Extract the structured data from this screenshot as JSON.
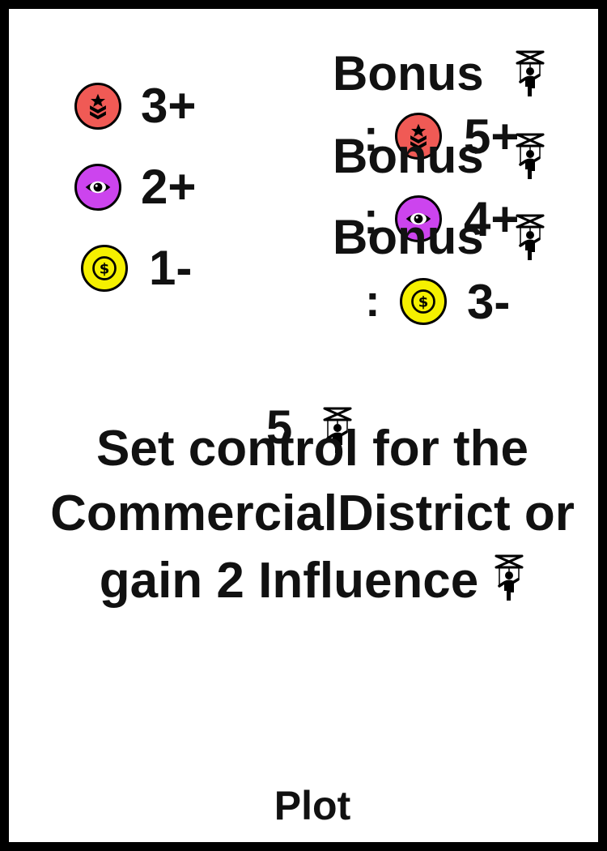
{
  "requirements": [
    {
      "icon": "military-badge-icon",
      "color": "#F05A55",
      "value": "3+"
    },
    {
      "icon": "eye-icon",
      "color": "#CC44EE",
      "value": "2+"
    },
    {
      "icon": "dollar-coin-icon",
      "color": "#F5F000",
      "value": "1-"
    }
  ],
  "bonuses": [
    {
      "label": "Bonus",
      "colon": ":",
      "icon": "military-badge-icon",
      "color": "#F05A55",
      "value": "5+",
      "reward_icon": "puppet-icon"
    },
    {
      "label": "Bonus",
      "colon": ":",
      "icon": "eye-icon",
      "color": "#CC44EE",
      "value": "4+",
      "reward_icon": "puppet-icon"
    },
    {
      "label": "Bonus",
      "colon": ":",
      "icon": "dollar-coin-icon",
      "color": "#F5F000",
      "value": "3-",
      "reward_icon": "puppet-icon"
    }
  ],
  "cost": {
    "value": "5",
    "icon": "puppet-icon"
  },
  "effect": {
    "line1": "Set control for the",
    "line2": "CommercialDistrict or",
    "line3": "gain 2 Influence",
    "line3_icon": "puppet-icon"
  },
  "card_type": "Plot"
}
